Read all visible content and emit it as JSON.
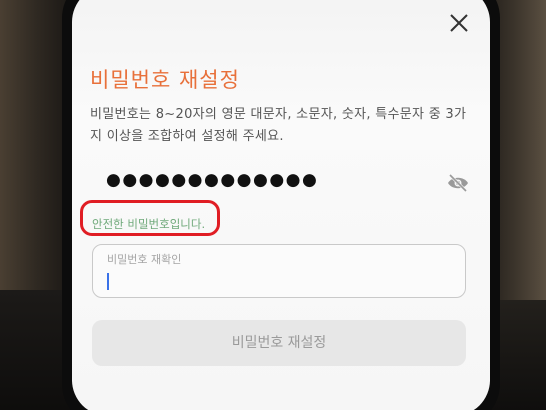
{
  "header": {
    "close_icon": "close-icon",
    "title": "비밀번호 재설정"
  },
  "instructions": "비밀번호는 8~20자의 영문 대문자, 소문자, 숫자, 특수문자 중 3가지 이상을 조합하여 설정해 주세요.",
  "password": {
    "masked_value": "●●●●●●●●●●●●●",
    "visibility_icon": "eye-slash-icon"
  },
  "password_status": "안전한 비밀번호입니다.",
  "confirm_field": {
    "placeholder": "비밀번호 재확인",
    "value": ""
  },
  "submit_label": "비밀번호 재설정",
  "colors": {
    "accent": "#e8703a",
    "status_ok": "#6fa97a",
    "highlight_annotation": "#e01d24",
    "button_disabled_bg": "#e7e7e7"
  }
}
